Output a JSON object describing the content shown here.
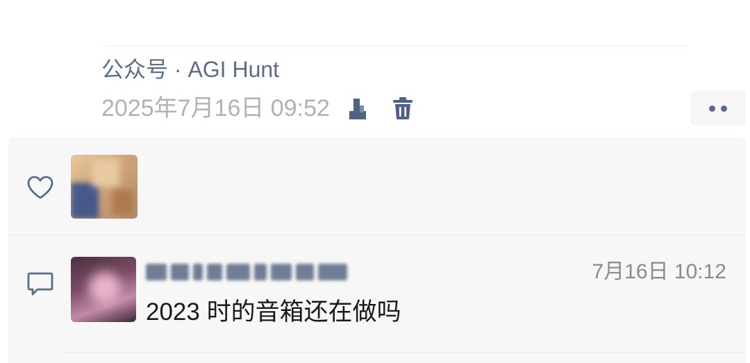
{
  "post": {
    "source": "公众号 · AGI Hunt",
    "timestamp": "2025年7月16日 09:52"
  },
  "icons": {
    "privacy": "person-privacy-icon",
    "delete": "trash-icon",
    "more": "more-dots-icon",
    "like": "heart-outline-icon",
    "comment": "comment-bubble-icon"
  },
  "likes": {
    "users": [
      {
        "avatar": "blurred-avatar"
      }
    ]
  },
  "comments": [
    {
      "author": "[blurred]",
      "time": "7月16日 10:12",
      "text": "2023 时的音箱还在做吗"
    }
  ],
  "colors": {
    "link_blue": "#5c6d87",
    "timestamp_gray": "#b2b2b2",
    "panel_bg": "#f7f7f7"
  }
}
